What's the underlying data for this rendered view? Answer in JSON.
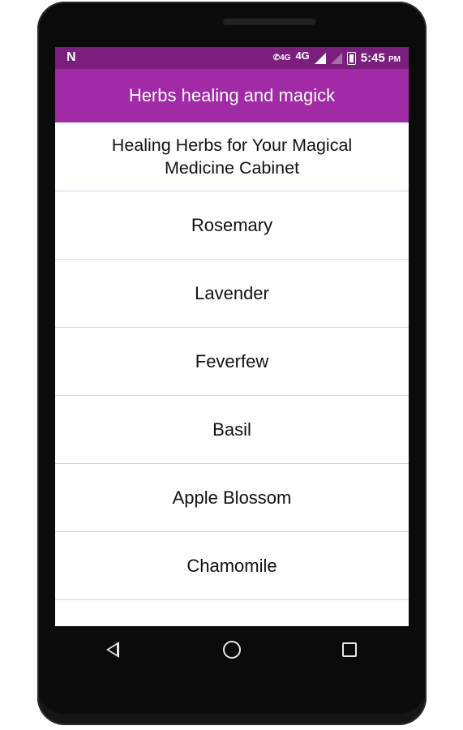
{
  "status_bar": {
    "notification_icon": "N",
    "call_network": "4G",
    "network_type": "4G",
    "time": "5:45",
    "ampm": "PM",
    "icons": [
      "notification-n-icon",
      "volte-call-icon",
      "signal-icon",
      "signal-empty-icon",
      "battery-icon"
    ]
  },
  "app_bar": {
    "title": "Herbs healing and magick"
  },
  "list": {
    "items": [
      {
        "label": "Healing Herbs for Your Magical Medicine Cabinet"
      },
      {
        "label": "Rosemary"
      },
      {
        "label": "Lavender"
      },
      {
        "label": "Feverfew"
      },
      {
        "label": "Basil"
      },
      {
        "label": "Apple Blossom"
      },
      {
        "label": "Chamomile"
      }
    ]
  },
  "nav_bar": {
    "icons": [
      "back-icon",
      "home-icon",
      "recents-icon"
    ]
  },
  "colors": {
    "status_bar": "#7a1f7e",
    "app_bar": "#a12aa6",
    "divider": "#e8c8ea",
    "phone_body": "#0b0b0b"
  }
}
